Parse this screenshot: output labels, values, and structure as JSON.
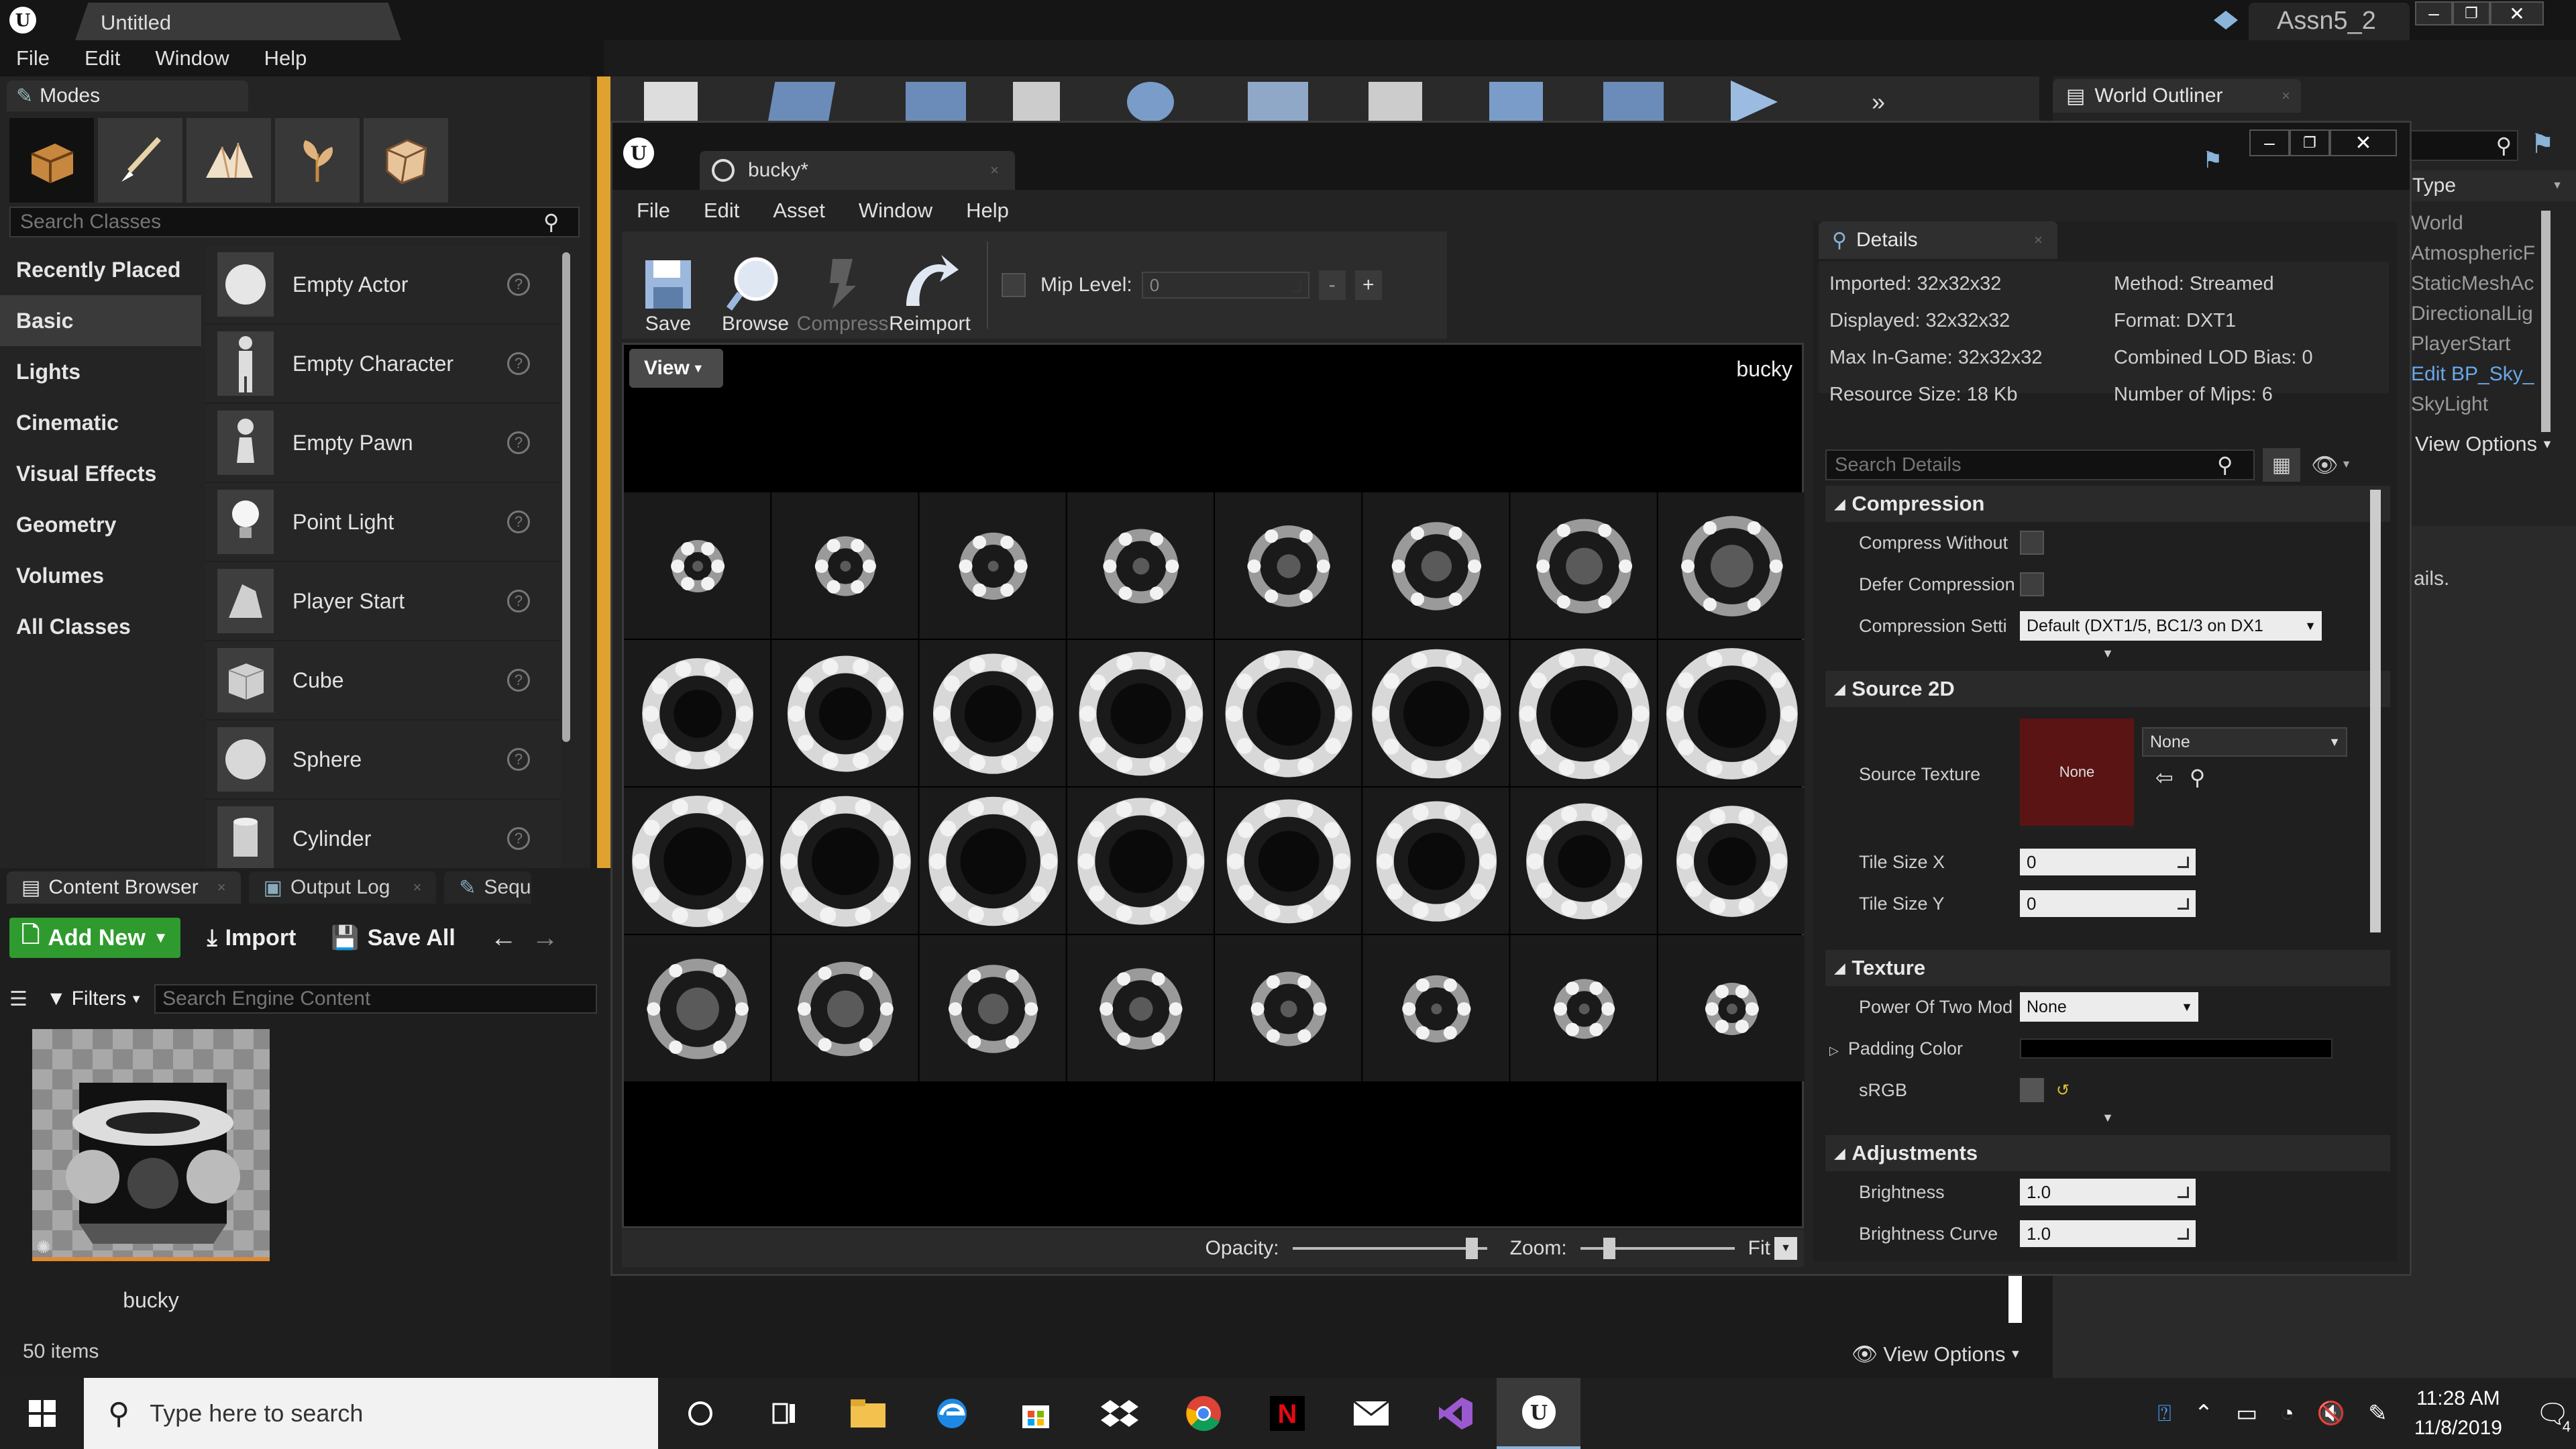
{
  "app": {
    "title_tab": "Untitled",
    "project": "Assn5_2",
    "menu": [
      "File",
      "Edit",
      "Window",
      "Help"
    ]
  },
  "modes": {
    "tab_label": "Modes",
    "search_placeholder": "Search Classes",
    "categories": [
      "Recently Placed",
      "Basic",
      "Lights",
      "Cinematic",
      "Visual Effects",
      "Geometry",
      "Volumes",
      "All Classes"
    ],
    "active_category": "Basic",
    "classes": [
      "Empty Actor",
      "Empty Character",
      "Empty Pawn",
      "Point Light",
      "Player Start",
      "Cube",
      "Sphere",
      "Cylinder"
    ]
  },
  "content_browser": {
    "tabs": [
      "Content Browser",
      "Output Log",
      "Sequ"
    ],
    "add_new": "Add New",
    "import": "Import",
    "save_all": "Save All",
    "filters": "Filters",
    "search_placeholder": "Search Engine Content",
    "asset_name": "bucky",
    "item_count": "50 items",
    "view_options": "View Options"
  },
  "texture_editor": {
    "tab_label": "bucky*",
    "menu": [
      "File",
      "Edit",
      "Asset",
      "Window",
      "Help"
    ],
    "toolbar": {
      "save": "Save",
      "browse": "Browse",
      "compress": "Compress",
      "reimport": "Reimport",
      "mip_label": "Mip Level:",
      "mip_value": "0",
      "minus": "-",
      "plus": "+"
    },
    "viewport": {
      "view_button": "View",
      "texture_name": "bucky",
      "opacity_label": "Opacity:",
      "zoom_label": "Zoom:",
      "fit_label": "Fit",
      "opacity": 0.95,
      "zoom": 0.16
    }
  },
  "details": {
    "tab_label": "Details",
    "info_left": [
      "Imported: 32x32x32",
      "Displayed: 32x32x32",
      "Max In-Game: 32x32x32",
      "Resource Size: 18 Kb"
    ],
    "info_right": [
      "Method: Streamed",
      "Format: DXT1",
      "Combined LOD Bias: 0",
      "Number of Mips: 6"
    ],
    "search_placeholder": "Search Details",
    "compression": {
      "title": "Compression",
      "compress_without": "Compress Without",
      "defer": "Defer Compression",
      "settings_label": "Compression Setti",
      "settings_value": "Default (DXT1/5, BC1/3 on DX1"
    },
    "source2d": {
      "title": "Source 2D",
      "source_texture": "Source Texture",
      "thumb_text": "None",
      "dropdown": "None",
      "tile_x": "Tile Size X",
      "tile_x_val": "0",
      "tile_y": "Tile Size Y",
      "tile_y_val": "0"
    },
    "texture": {
      "title": "Texture",
      "pot_label": "Power Of Two Mod",
      "pot_value": "None",
      "padding_color": "Padding Color",
      "srgb": "sRGB"
    },
    "adjustments": {
      "title": "Adjustments",
      "brightness": "Brightness",
      "brightness_val": "1.0",
      "brightness_curve": "Brightness Curve",
      "brightness_curve_val": "1.0"
    }
  },
  "outliner": {
    "tab_label": "World Outliner",
    "type_header": "Type",
    "items": [
      "World",
      "AtmosphericF",
      "StaticMeshAc",
      "DirectionalLig",
      "PlayerStart",
      "Edit BP_Sky_",
      "SkyLight"
    ],
    "view_options": "View Options",
    "details_fragment": "ails."
  },
  "taskbar": {
    "search_placeholder": "Type here to search",
    "time": "11:28 AM",
    "date": "11/8/2019",
    "notif_count": "4"
  },
  "colors": {
    "accent_green": "#2f9b2f",
    "selected_orange": "#e08a2e",
    "source_thumb": "#5a1414"
  }
}
